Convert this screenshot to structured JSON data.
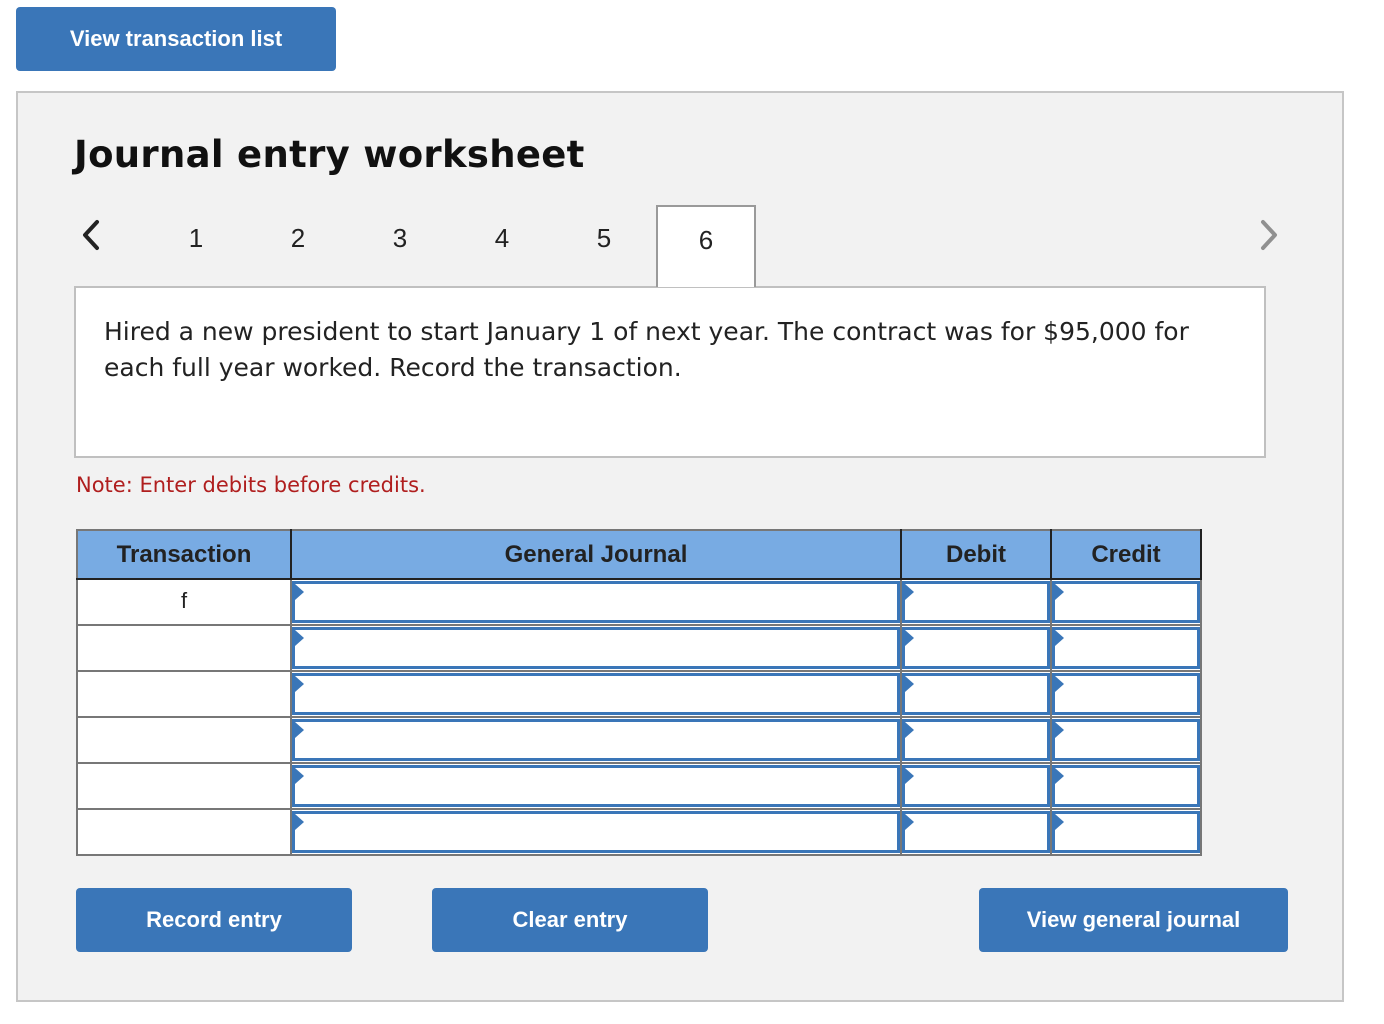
{
  "top_button": {
    "label": "View transaction list"
  },
  "worksheet": {
    "title": "Journal entry worksheet",
    "nav": {
      "prev_icon": "chevron-left-icon",
      "next_icon": "chevron-right-icon"
    },
    "tabs": [
      {
        "label": "1",
        "active": false
      },
      {
        "label": "2",
        "active": false
      },
      {
        "label": "3",
        "active": false
      },
      {
        "label": "4",
        "active": false
      },
      {
        "label": "5",
        "active": false
      },
      {
        "label": "6",
        "active": true
      }
    ],
    "question": "Hired a new president to start January 1 of next year. The contract was for $95,000 for each full year worked. Record the transaction.",
    "note": "Note: Enter debits before credits.",
    "table": {
      "headers": [
        "Transaction",
        "General Journal",
        "Debit",
        "Credit"
      ],
      "rows": [
        {
          "transaction": "f",
          "account": "",
          "debit": "",
          "credit": ""
        },
        {
          "transaction": "",
          "account": "",
          "debit": "",
          "credit": ""
        },
        {
          "transaction": "",
          "account": "",
          "debit": "",
          "credit": ""
        },
        {
          "transaction": "",
          "account": "",
          "debit": "",
          "credit": ""
        },
        {
          "transaction": "",
          "account": "",
          "debit": "",
          "credit": ""
        },
        {
          "transaction": "",
          "account": "",
          "debit": "",
          "credit": ""
        }
      ]
    },
    "buttons": {
      "record": "Record entry",
      "clear": "Clear entry",
      "view_journal": "View general journal"
    }
  },
  "colors": {
    "button_blue": "#3a76b8",
    "header_blue": "#78abe3",
    "note_red": "#b01e1e",
    "panel_bg": "#f2f2f2"
  }
}
